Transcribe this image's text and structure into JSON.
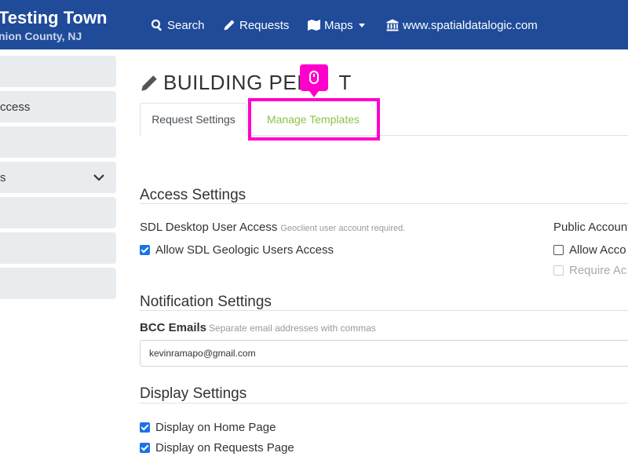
{
  "header": {
    "title": "Testing Town",
    "subtitle": "nion County, NJ"
  },
  "nav": {
    "search": "Search",
    "requests": "Requests",
    "maps": "Maps",
    "site": "www.spatialdatalogic.com"
  },
  "sidebar": {
    "items": [
      {
        "label": ""
      },
      {
        "label": "ccess"
      },
      {
        "label": ""
      },
      {
        "label": "s"
      },
      {
        "label": ""
      },
      {
        "label": ""
      },
      {
        "label": ""
      }
    ]
  },
  "page": {
    "title": "BUILDING PER",
    "title_tail": "T"
  },
  "tabs": {
    "request_settings": "Request Settings",
    "manage_templates": "Manage Templates"
  },
  "access": {
    "heading": "Access Settings",
    "desktop_label": "SDL Desktop User Access",
    "desktop_hint": "Geoclient user account required.",
    "allow_geologic": "Allow SDL Geologic Users Access",
    "public_label": "Public Account",
    "allow_acco": "Allow Acco",
    "require_ac": "Require Ac"
  },
  "notification": {
    "heading": "Notification Settings",
    "bcc_label": "BCC Emails",
    "bcc_hint": "Separate email addresses with commas",
    "bcc_value": "kevinramapo@gmail.com"
  },
  "display": {
    "heading": "Display Settings",
    "home": "Display on Home Page",
    "requests": "Display on Requests Page"
  },
  "colors": {
    "navbar": "#1f4b99",
    "highlight": "#ff00cc",
    "tab_link": "#8bc34a",
    "checkbox": "#1a73e8"
  }
}
